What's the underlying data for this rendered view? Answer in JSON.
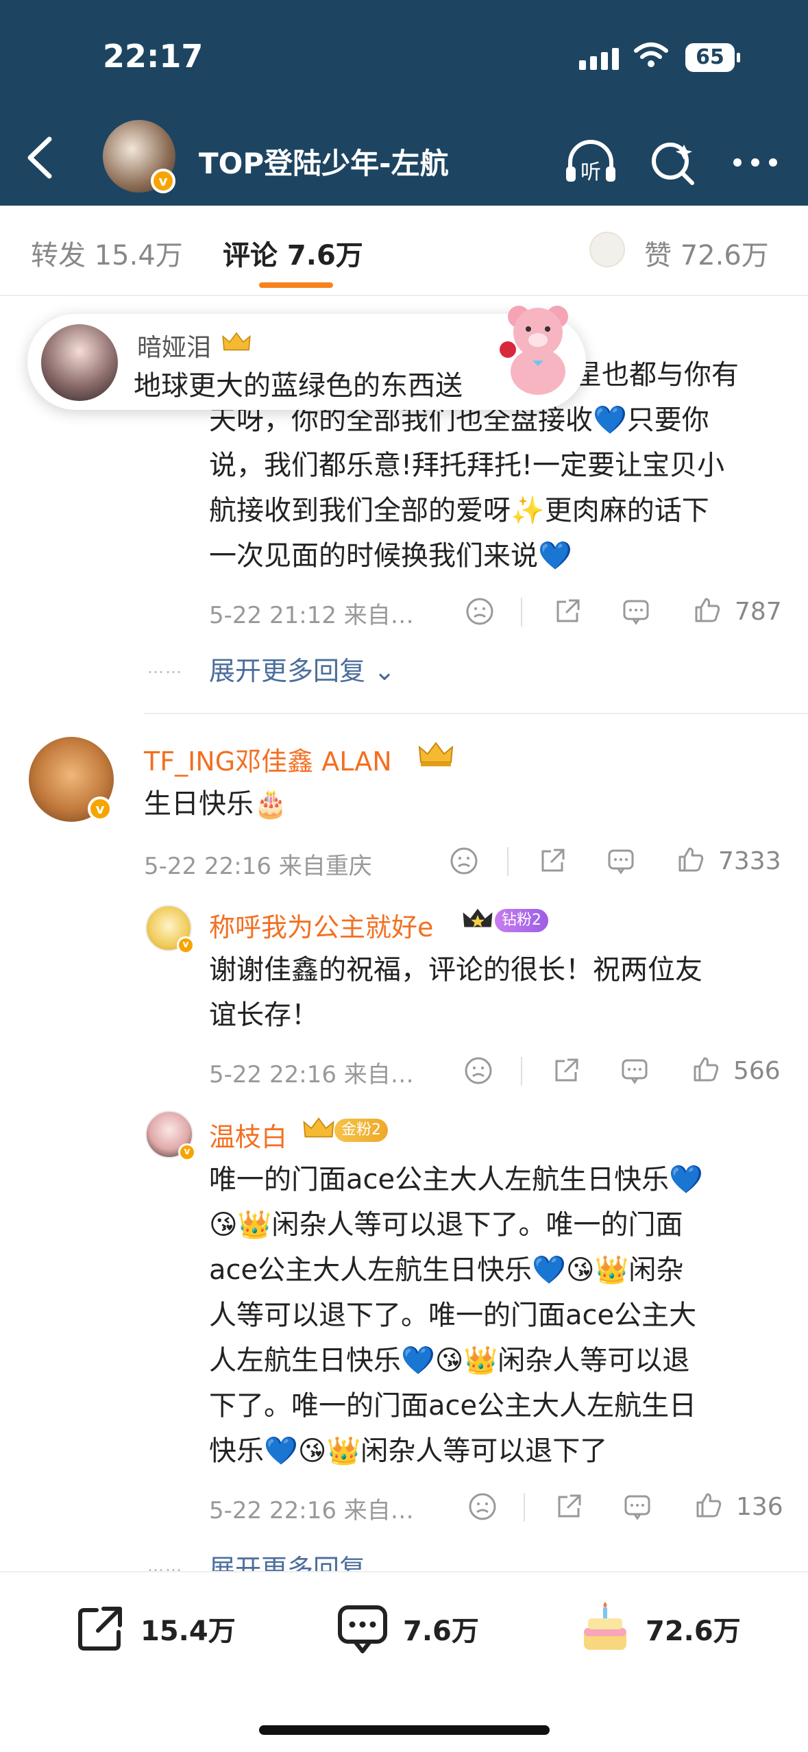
{
  "status_bar": {
    "time": "22:17",
    "battery": "65"
  },
  "header": {
    "title": "TOP登陆少年-左航",
    "listen_label": "听"
  },
  "tabs": {
    "repost": "转发 15.4万",
    "comments": "评论 7.6万",
    "likes": "赞 72.6万"
  },
  "toast": {
    "name": "暗娅泪",
    "text": "地球更大的蓝绿色的东西送"
  },
  "comments": {
    "first_partial": {
      "lines": [
        "星也都与你有",
        "天呀，你的全部我们也全盘接收💙只要你",
        "说，我们都乐意!拜托拜托!一定要让宝贝小",
        "航接收到我们全部的爱呀✨更肉麻的话下",
        "一次见面的时候换我们来说💙"
      ],
      "meta": "5-22 21:12  来自…",
      "likes": "787",
      "more": "展开更多回复"
    },
    "main": {
      "name": "TF_ING邓佳鑫 ALAN",
      "text": "生日快乐🎂",
      "meta": "5-22 22:16  来自重庆",
      "likes": "7333"
    },
    "reply1": {
      "name": "称呼我为公主就好e",
      "badge": "钻粉2",
      "lines": [
        "谢谢佳鑫的祝福，评论的很长！祝两位友",
        "谊长存！"
      ],
      "meta": "5-22 22:16  来自…",
      "likes": "566"
    },
    "reply2": {
      "name": "温枝白",
      "badge": "金粉2",
      "lines": [
        "唯一的门面ace公主大人左航生日快乐💙",
        "😘👑闲杂人等可以退下了。唯一的门面",
        "ace公主大人左航生日快乐💙😘👑闲杂",
        "人等可以退下了。唯一的门面ace公主大",
        "人左航生日快乐💙😘👑闲杂人等可以退",
        "下了。唯一的门面ace公主大人左航生日",
        "快乐💙😘👑闲杂人等可以退下了"
      ],
      "meta": "5-22 22:16  来自…",
      "likes": "136",
      "more": "展开更多回复"
    }
  },
  "bottom_bar": {
    "repost": "15.4万",
    "comment": "7.6万",
    "like": "72.6万"
  }
}
